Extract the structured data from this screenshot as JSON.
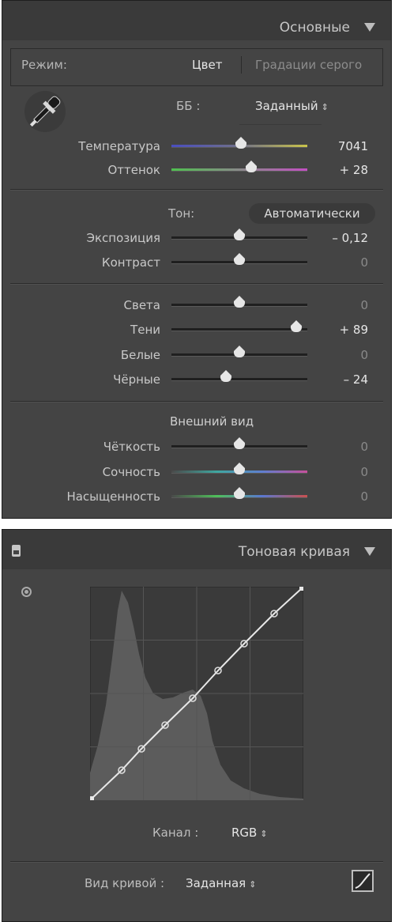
{
  "basic": {
    "title": "Основные",
    "mode": {
      "label": "Режим:",
      "option_color": "Цвет",
      "option_gray": "Градации серого"
    },
    "wb": {
      "label": "ББ :",
      "value": "Заданный"
    },
    "temperature": {
      "label": "Температура",
      "value": "7041",
      "level": 0.51
    },
    "tint": {
      "label": "Оттенок",
      "value": "+ 28",
      "level": 0.59
    },
    "tone": {
      "label": "Тон:",
      "auto_label": "Автоматически"
    },
    "exposure": {
      "label": "Экспозиция",
      "value": "– 0,12",
      "level": 0.5
    },
    "contrast": {
      "label": "Контраст",
      "value": "0",
      "level": 0.5
    },
    "highlights": {
      "label": "Света",
      "value": "0",
      "level": 0.5
    },
    "shadows": {
      "label": "Тени",
      "value": "+ 89",
      "level": 0.92
    },
    "whites": {
      "label": "Белые",
      "value": "0",
      "level": 0.5
    },
    "blacks": {
      "label": "Чёрные",
      "value": "– 24",
      "level": 0.4
    },
    "presence": {
      "label": "Внешний вид"
    },
    "clarity": {
      "label": "Чёткость",
      "value": "0",
      "level": 0.5
    },
    "vibrance": {
      "label": "Сочность",
      "value": "0",
      "level": 0.5
    },
    "saturation": {
      "label": "Насыщенность",
      "value": "0",
      "level": 0.5
    }
  },
  "curve": {
    "title": "Тоновая кривая",
    "channel": {
      "label": "Канал :",
      "value": "RGB"
    },
    "point_curve": {
      "label": "Вид кривой :",
      "value": "Заданная"
    },
    "icons": [
      "panel-switch-icon",
      "target-adjust-icon",
      "curve-edit-icon",
      "eyedropper-icon",
      "collapse-triangle-icon"
    ]
  }
}
